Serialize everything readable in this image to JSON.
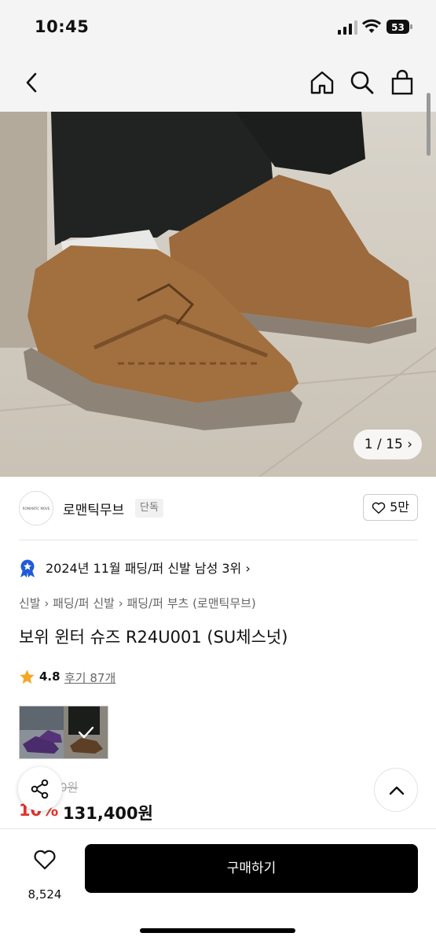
{
  "status": {
    "time": "10:45",
    "battery": "53"
  },
  "nav": {
    "back_icon": "chevron-left-icon",
    "home_icon": "home-icon",
    "search_icon": "search-icon",
    "bag_icon": "shopping-bag-icon"
  },
  "gallery": {
    "counter": "1 / 15"
  },
  "brand": {
    "logo_text": "ROMANTIC MOVE",
    "name": "로맨틱무브",
    "tag": "단독",
    "likes": "5만"
  },
  "rank": {
    "text": "2024년 11월 패딩/퍼 신발 남성 3위 ›"
  },
  "breadcrumb": {
    "text": "신발 › 패딩/퍼 신발 › 패딩/퍼 부츠 (로맨틱무브)"
  },
  "product": {
    "title": "보위 윈터 슈즈 R24U001 (SU체스넛)"
  },
  "rating": {
    "score": "4.8",
    "reviews": "후기 87개"
  },
  "price": {
    "original": "0원",
    "discount": "10%",
    "final": "131,400원"
  },
  "bottom": {
    "wish_count": "8,524",
    "buy_label": "구매하기"
  },
  "colors": {
    "accent": "#e3342f",
    "buy_bg": "#000000"
  }
}
